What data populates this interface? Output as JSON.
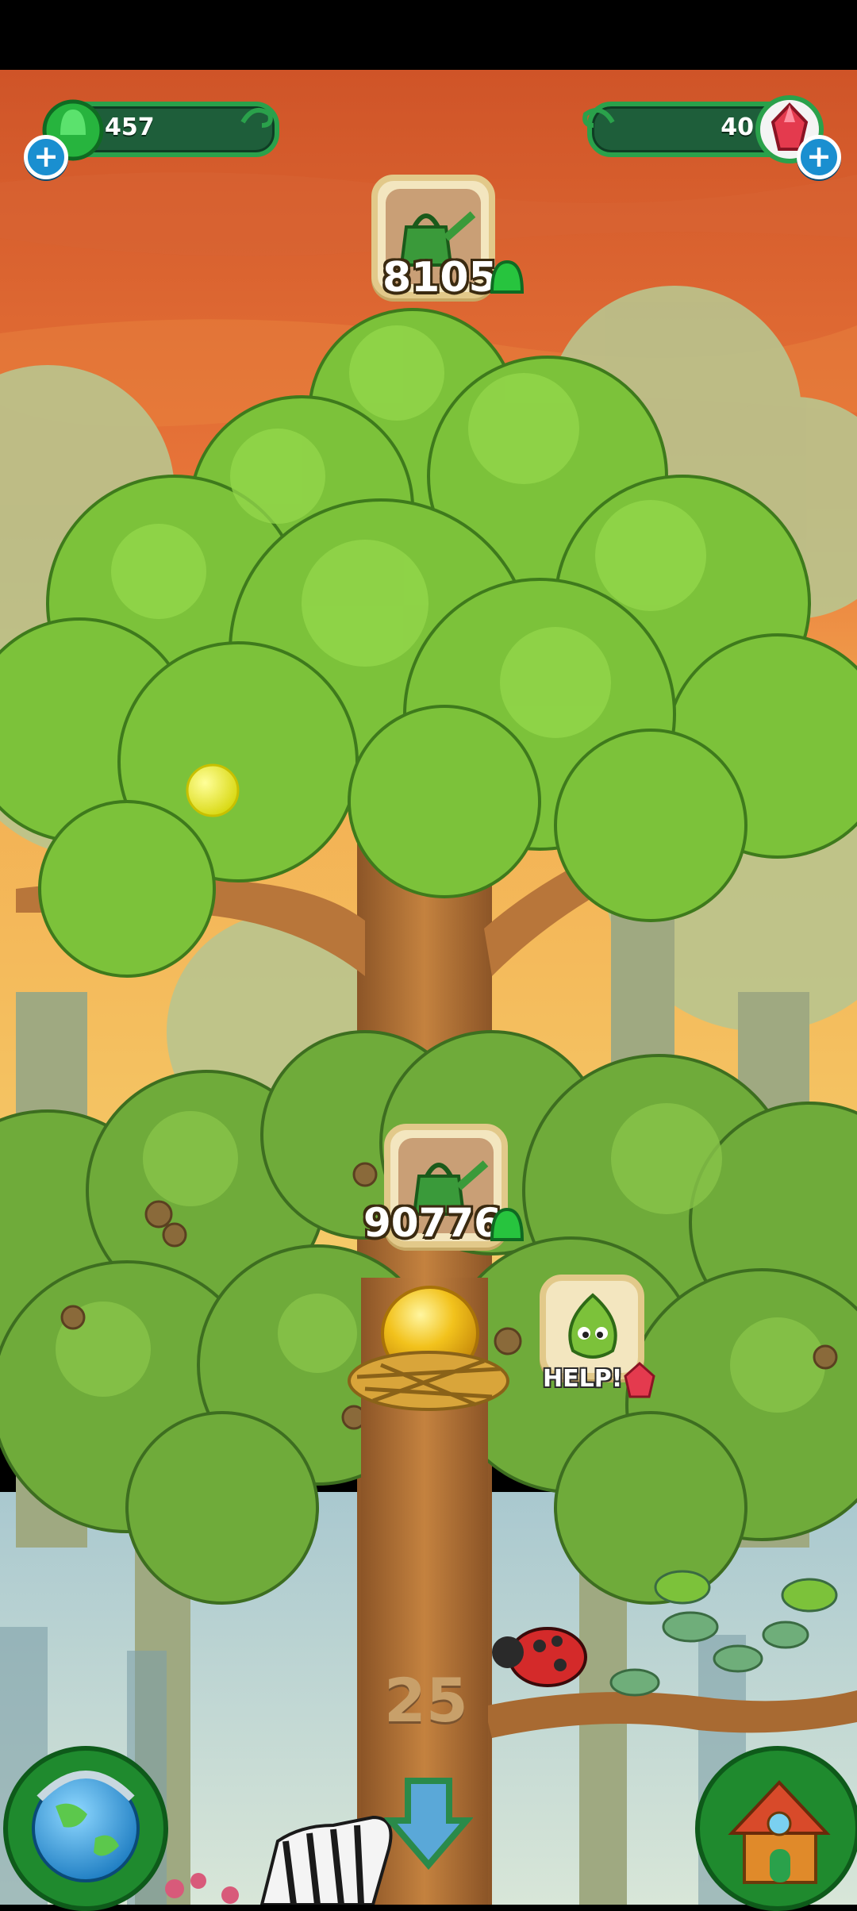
{
  "hud": {
    "seeds_count": "457",
    "gems_count": "40",
    "seed_icon": "green-drop-icon",
    "gem_icon": "red-gem-icon",
    "add_icon": "plus-icon"
  },
  "tree_bubbles": [
    {
      "icon": "watering-can-icon",
      "cost": "8105",
      "cost_icon": "green-drop-icon"
    },
    {
      "icon": "watering-can-icon",
      "cost": "90776",
      "cost_icon": "green-drop-icon"
    }
  ],
  "help_bubble": {
    "label": "HELP!",
    "icon": "leaf-character-icon",
    "reward_icon": "red-gem-icon"
  },
  "floor_number": "25",
  "bottom_nav": {
    "left_icon": "globe-icon",
    "center_icon": "down-arrow-icon",
    "right_icon": "house-icon"
  },
  "colors": {
    "sky_top": "#d6572a",
    "sky_bottom": "#f0a040",
    "leaf": "#7cc23a",
    "trunk": "#b8763a",
    "hud_green": "#1e5e3a"
  }
}
